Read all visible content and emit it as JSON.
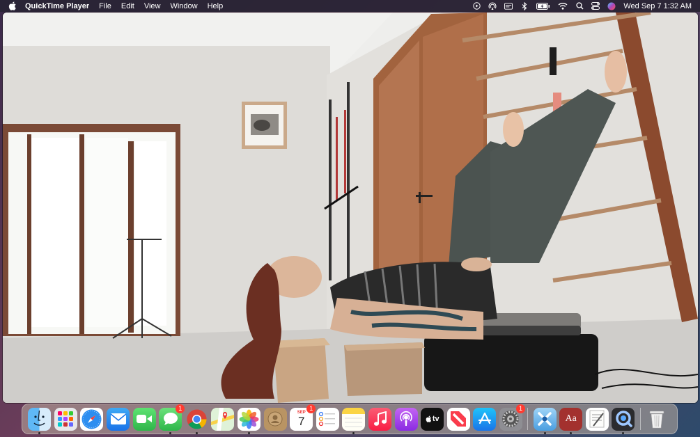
{
  "menubar": {
    "app_name": "QuickTime Player",
    "menus": [
      "File",
      "Edit",
      "View",
      "Window",
      "Help"
    ],
    "clock": "Wed Sep 7  1:32 AM",
    "status_icons": [
      "screen-record-icon",
      "airdrop-icon",
      "keyboard-brightness-icon",
      "bluetooth-icon",
      "battery-charging-icon",
      "wifi-icon",
      "spotlight-search-icon",
      "control-center-icon",
      "siri-icon"
    ]
  },
  "dock": {
    "apps": [
      {
        "name": "finder",
        "icon": "finder-icon",
        "running": true,
        "badge": ""
      },
      {
        "name": "launchpad",
        "icon": "launchpad-icon",
        "running": false,
        "badge": ""
      },
      {
        "name": "safari",
        "icon": "safari-icon",
        "running": false,
        "badge": ""
      },
      {
        "name": "mail",
        "icon": "mail-icon",
        "running": false,
        "badge": ""
      },
      {
        "name": "facetime",
        "icon": "facetime-icon",
        "running": false,
        "badge": ""
      },
      {
        "name": "messages",
        "icon": "messages-icon",
        "running": true,
        "badge": "1"
      },
      {
        "name": "chrome",
        "icon": "chrome-icon",
        "running": true,
        "badge": ""
      },
      {
        "name": "maps",
        "icon": "maps-icon",
        "running": false,
        "badge": ""
      },
      {
        "name": "photos",
        "icon": "photos-icon",
        "running": true,
        "badge": ""
      },
      {
        "name": "contacts",
        "icon": "contacts-icon",
        "running": false,
        "badge": ""
      },
      {
        "name": "calendar",
        "icon": "calendar-icon",
        "running": false,
        "badge": "1",
        "month": "SEP",
        "day": "7"
      },
      {
        "name": "reminders",
        "icon": "reminders-icon",
        "running": false,
        "badge": ""
      },
      {
        "name": "notes",
        "icon": "notes-icon",
        "running": true,
        "badge": ""
      },
      {
        "name": "music",
        "icon": "music-icon",
        "running": false,
        "badge": ""
      },
      {
        "name": "podcasts",
        "icon": "podcasts-icon",
        "running": false,
        "badge": ""
      },
      {
        "name": "tv",
        "icon": "apple-tv-icon",
        "running": false,
        "badge": "",
        "label": "tv"
      },
      {
        "name": "news",
        "icon": "news-icon",
        "running": false,
        "badge": ""
      },
      {
        "name": "app-store",
        "icon": "app-store-icon",
        "running": false,
        "badge": ""
      },
      {
        "name": "system-preferences",
        "icon": "system-preferences-icon",
        "running": false,
        "badge": "1"
      },
      {
        "name": "xcode-instruments",
        "icon": "xcode-icon",
        "running": true,
        "badge": ""
      },
      {
        "name": "dictionary",
        "icon": "dictionary-icon",
        "running": true,
        "badge": "",
        "label": "Aa"
      },
      {
        "name": "textedit",
        "icon": "textedit-icon",
        "running": false,
        "badge": ""
      },
      {
        "name": "quicktime-player",
        "icon": "quicktime-icon",
        "running": true,
        "badge": ""
      },
      {
        "name": "trash",
        "icon": "trash-icon",
        "running": false,
        "badge": ""
      }
    ]
  },
  "video": {
    "description_icon": "video-frame"
  },
  "colors": {
    "menubar_bg": "#28243a",
    "badge": "#ff3b30"
  }
}
